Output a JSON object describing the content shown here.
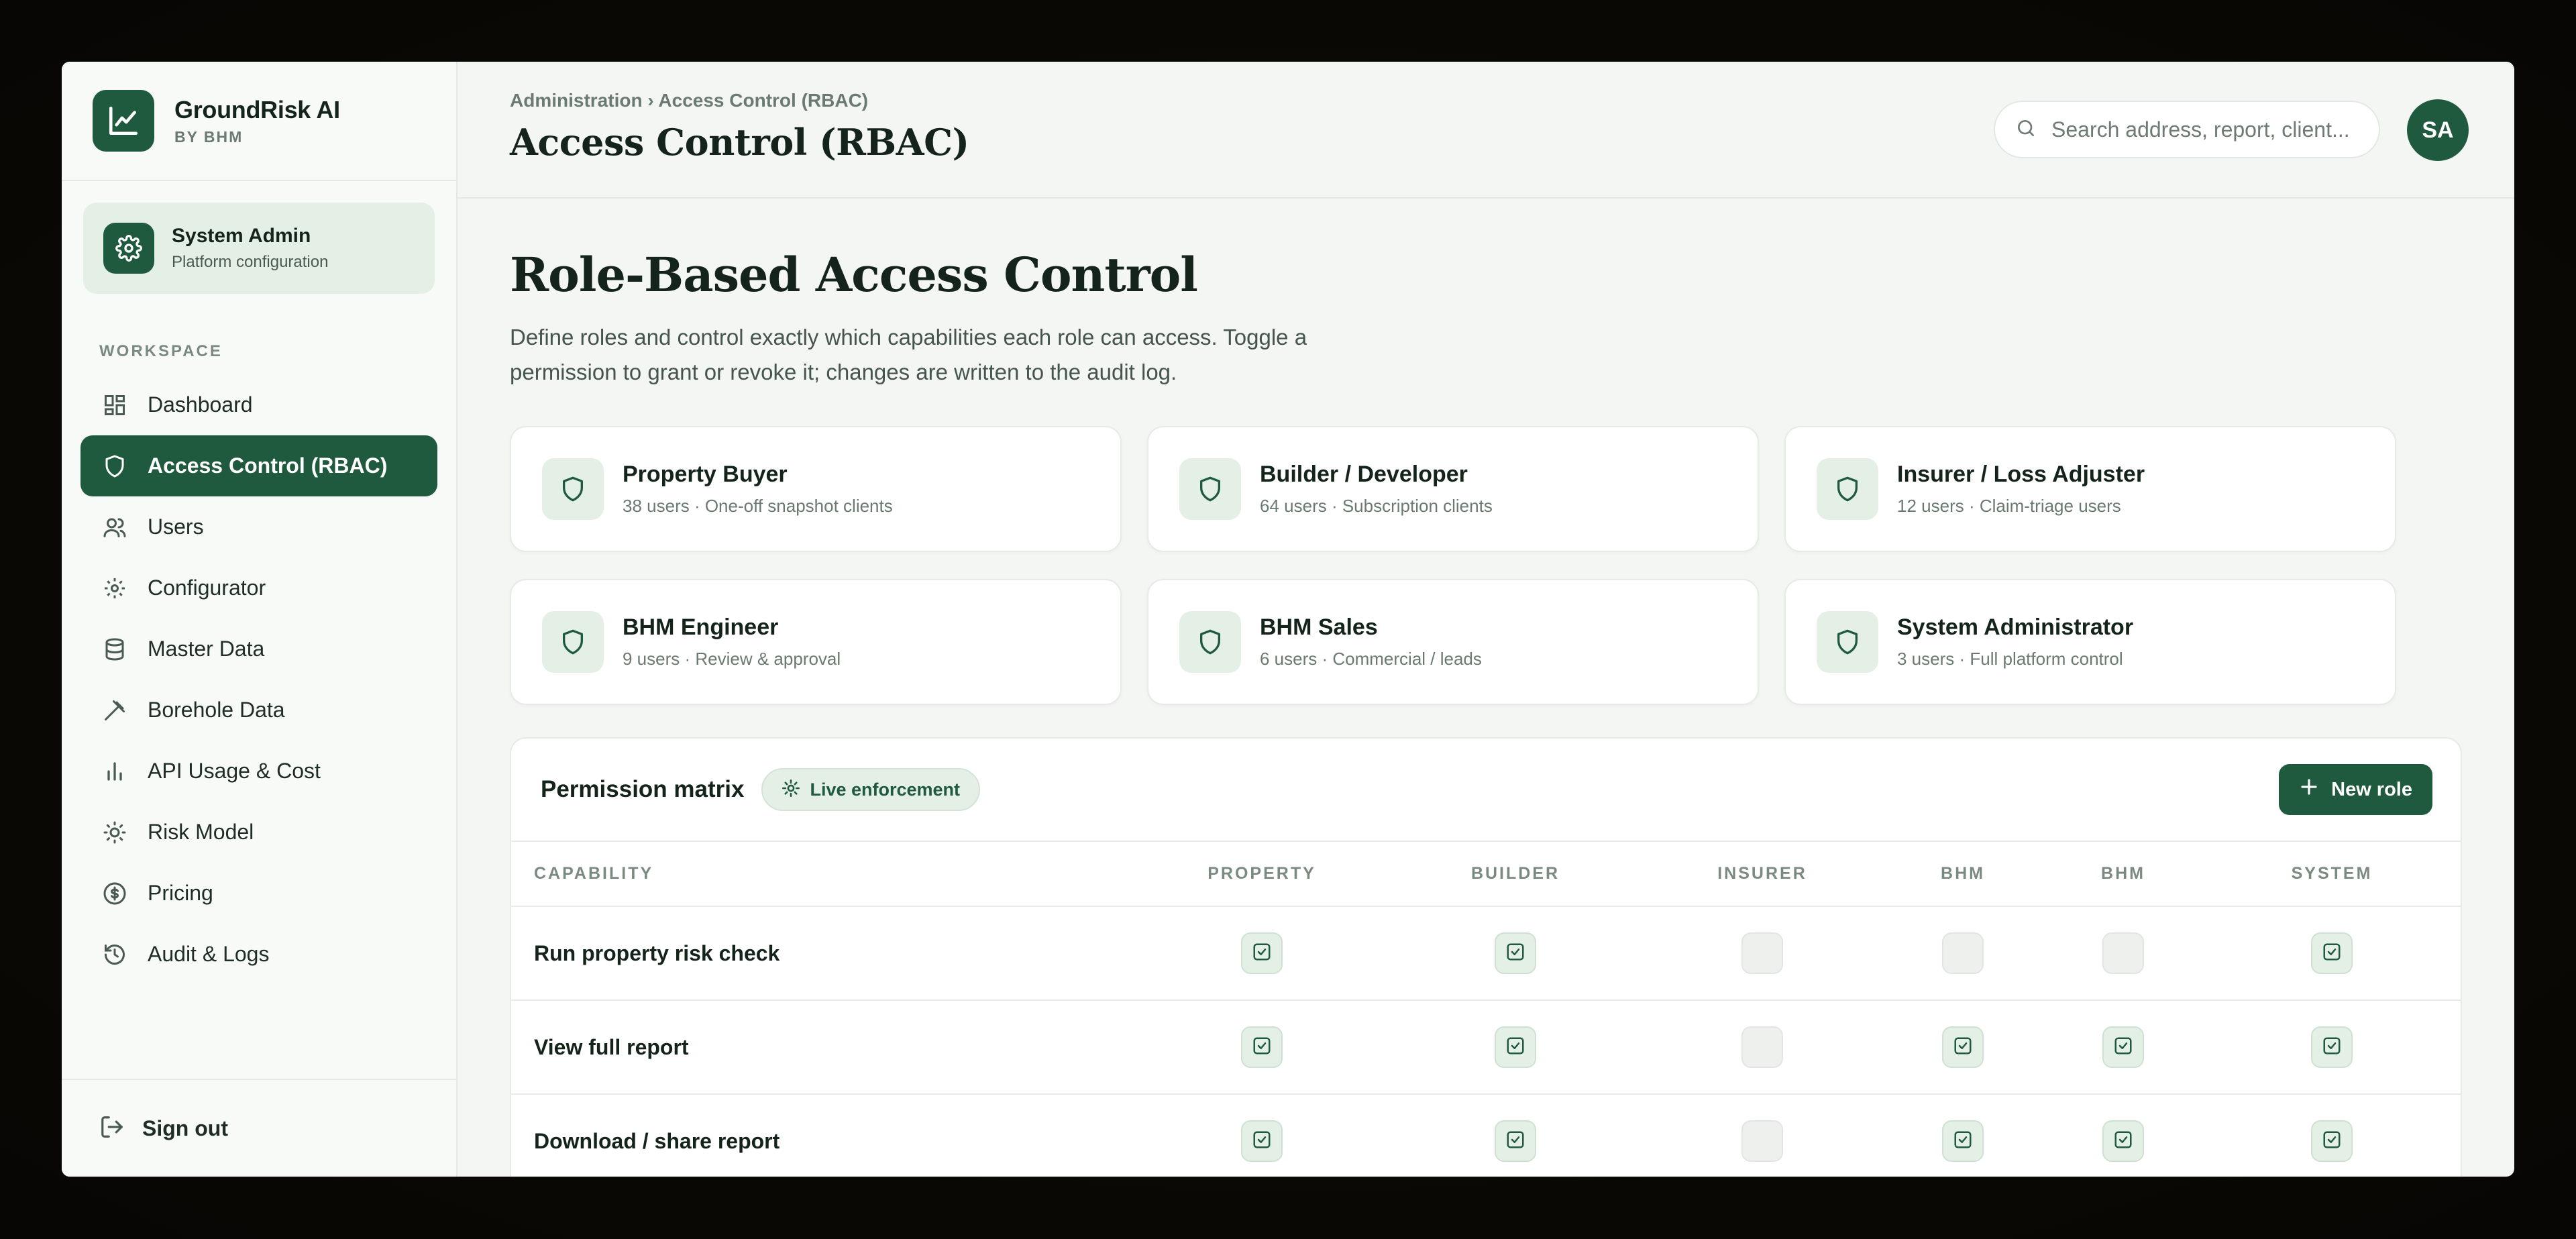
{
  "brand": {
    "name": "GroundRisk AI",
    "sub": "BY BHM"
  },
  "admin": {
    "title": "System Admin",
    "sub": "Platform configuration"
  },
  "sidebar": {
    "section": "WORKSPACE",
    "items": [
      {
        "label": "Dashboard",
        "icon": "dashboard-icon"
      },
      {
        "label": "Access Control (RBAC)",
        "icon": "shield-icon",
        "active": true
      },
      {
        "label": "Users",
        "icon": "users-icon"
      },
      {
        "label": "Configurator",
        "icon": "gear-icon"
      },
      {
        "label": "Master Data",
        "icon": "database-icon"
      },
      {
        "label": "Borehole Data",
        "icon": "drill-icon"
      },
      {
        "label": "API Usage & Cost",
        "icon": "bar-chart-icon"
      },
      {
        "label": "Risk Model",
        "icon": "sun-icon"
      },
      {
        "label": "Pricing",
        "icon": "dollar-icon"
      },
      {
        "label": "Audit & Logs",
        "icon": "history-icon"
      }
    ],
    "signout": "Sign out"
  },
  "header": {
    "breadcrumb_parent": "Administration",
    "breadcrumb_sep": "›",
    "breadcrumb_current": "Access Control (RBAC)",
    "title": "Access Control (RBAC)",
    "search_placeholder": "Search address, report, client...",
    "avatar": "SA"
  },
  "page": {
    "heading": "Role-Based Access Control",
    "description": "Define roles and control exactly which capabilities each role can access. Toggle a permission to grant or revoke it; changes are written to the audit log."
  },
  "roles": [
    {
      "name": "Property Buyer",
      "meta": "38 users · One-off snapshot clients"
    },
    {
      "name": "Builder / Developer",
      "meta": "64 users · Subscription clients"
    },
    {
      "name": "Insurer / Loss Adjuster",
      "meta": "12 users · Claim-triage users"
    },
    {
      "name": "BHM Engineer",
      "meta": "9 users · Review & approval"
    },
    {
      "name": "BHM Sales",
      "meta": "6 users · Commercial / leads"
    },
    {
      "name": "System Administrator",
      "meta": "3 users · Full platform control"
    }
  ],
  "matrix": {
    "title": "Permission matrix",
    "live_label": "Live enforcement",
    "new_role_label": "New role",
    "columns": [
      "CAPABILITY",
      "PROPERTY",
      "BUILDER",
      "INSURER",
      "BHM",
      "BHM",
      "SYSTEM"
    ],
    "rows": [
      {
        "capability": "Run property risk check",
        "perms": [
          true,
          true,
          false,
          false,
          false,
          true
        ]
      },
      {
        "capability": "View full report",
        "perms": [
          true,
          true,
          false,
          true,
          true,
          true
        ]
      },
      {
        "capability": "Download / share report",
        "perms": [
          true,
          true,
          false,
          true,
          true,
          true
        ]
      }
    ]
  },
  "colors": {
    "accent": "#1f5a3f",
    "accent_soft": "#e4efe6",
    "background": "#f4f6f3"
  }
}
